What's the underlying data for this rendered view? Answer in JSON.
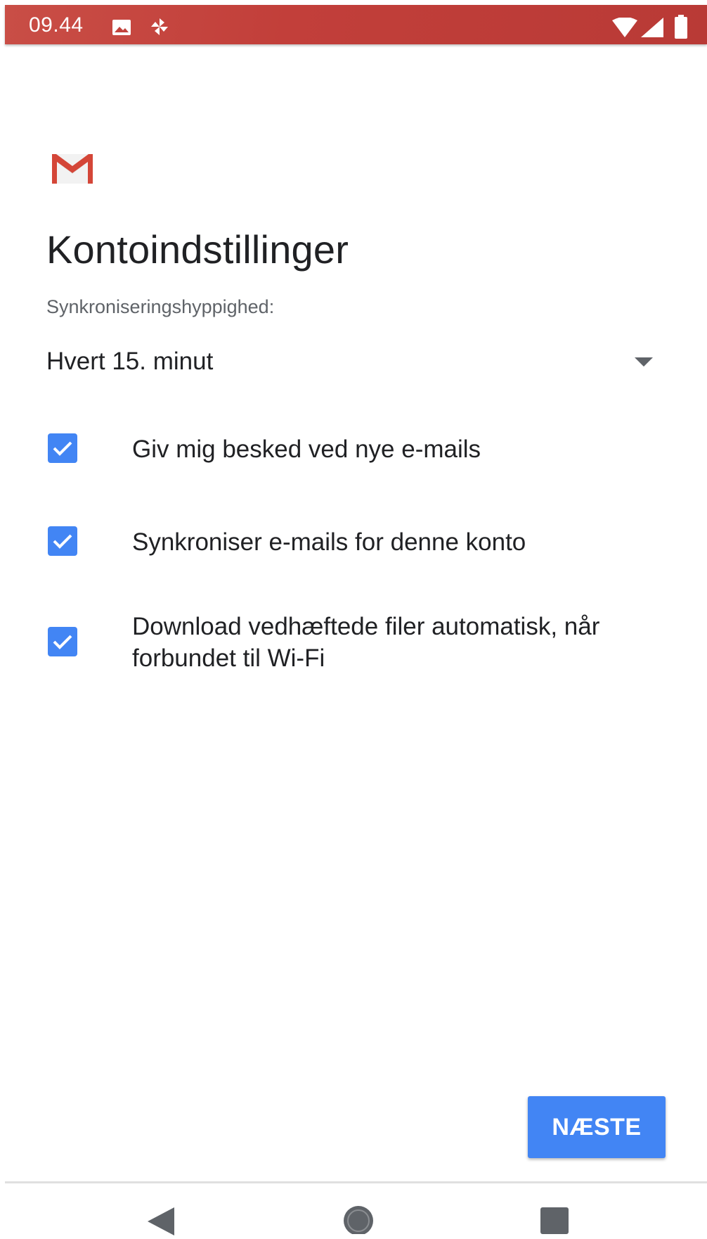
{
  "status_bar": {
    "time": "09.44",
    "icons": [
      "image-icon",
      "sync-pinwheel-icon",
      "wifi-icon",
      "signal-icon",
      "battery-icon"
    ]
  },
  "app": {
    "logo": "gmail-m-logo",
    "colors": {
      "accent": "#4285f4",
      "status_bar": "#c2423c",
      "logo_red": "#d44638"
    }
  },
  "page": {
    "title": "Kontoindstillinger",
    "sync_frequency_label": "Synkroniseringshyppighed:",
    "sync_frequency_value": "Hvert 15. minut"
  },
  "options": [
    {
      "label": "Giv mig besked ved nye e-mails",
      "checked": true
    },
    {
      "label": "Synkroniser e-mails for denne konto",
      "checked": true
    },
    {
      "label": "Download vedhæftede filer automatisk, når forbundet til Wi-Fi",
      "checked": true
    }
  ],
  "actions": {
    "next_label": "NÆSTE"
  },
  "nav_bar": {
    "icons": [
      "back-icon",
      "home-icon",
      "recents-icon"
    ]
  }
}
